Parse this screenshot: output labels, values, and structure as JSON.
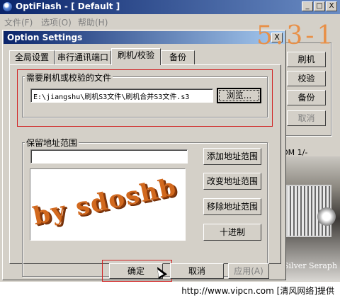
{
  "window": {
    "title": "OptiFlash - [ Default ]",
    "controls": {
      "minimize": "_",
      "maximize": "□",
      "close": "X"
    }
  },
  "menu": {
    "file": "文件(F)",
    "options": "选项(O)",
    "help": "帮助(H)"
  },
  "main_panel": {
    "buttons": {
      "flash": "刷机",
      "verify": "校验",
      "backup": "备份",
      "cancel": "取消"
    },
    "rom_label": "OM 1/-",
    "car_caption": "Silver Seraph"
  },
  "decor": {
    "version_text": "5.3-1"
  },
  "dialog": {
    "title": "Option Settings",
    "close": "X",
    "tabs": [
      "全局设置",
      "串行通讯端口",
      "刷机/校验",
      "备份"
    ],
    "active_tab": 2,
    "file_group": {
      "label": "需要刷机或校验的文件",
      "path": "E:\\jiangshu\\刷机S3文件\\刷机合并S3文件.s3",
      "browse": "浏览..."
    },
    "range_group": {
      "label": "保留地址范围",
      "input_value": "",
      "add": "添加地址范围",
      "change": "改变地址范围",
      "remove": "移除地址范围",
      "hex": "十进制",
      "watermark": "by sdoshb"
    },
    "footer": {
      "ok": "确定",
      "cancel": "取消",
      "apply": "应用(A)"
    }
  },
  "status": {
    "text": "http://www.vipcn.com [清风网络]提供"
  },
  "colors": {
    "titlebar": "#0a246a",
    "highlight": "#d02020",
    "face": "#d4d0c8"
  }
}
